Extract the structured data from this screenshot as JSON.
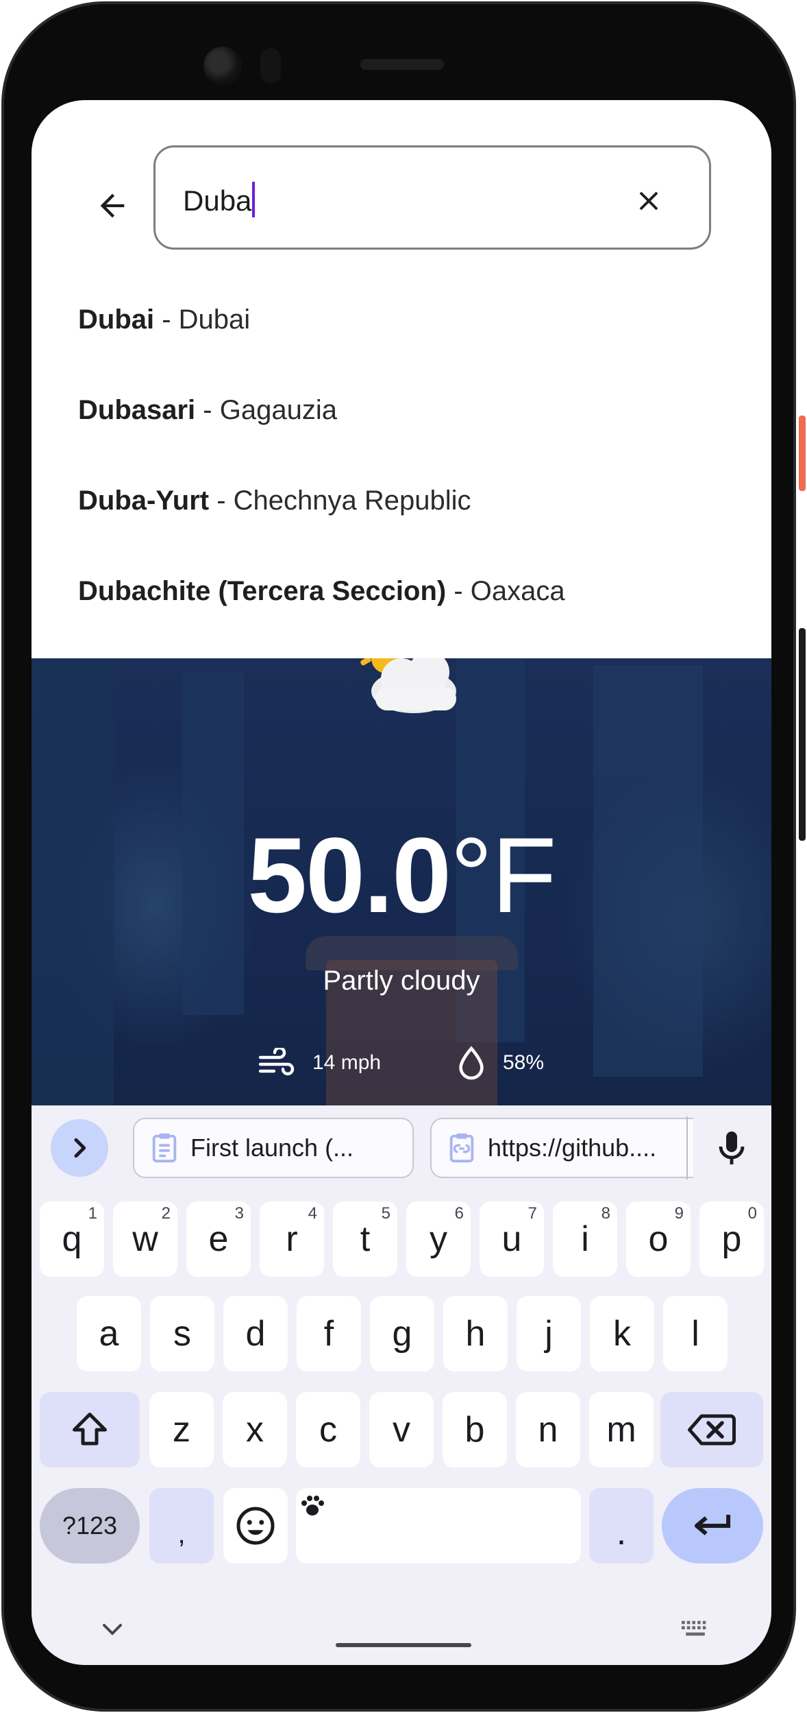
{
  "search": {
    "query": "Duba",
    "back_icon": "arrow-back-icon",
    "clear_icon": "close-icon"
  },
  "suggestions": [
    {
      "name": "Dubai",
      "region": " - Dubai"
    },
    {
      "name": "Dubasari",
      "region": " - Gagauzia"
    },
    {
      "name": "Duba-Yurt",
      "region": " - Chechnya Republic"
    },
    {
      "name": "Dubachite (Tercera Seccion)",
      "region": " - Oaxaca"
    }
  ],
  "weather": {
    "temperature": "50.0",
    "unit": "°F",
    "condition": "Partly cloudy",
    "wind": "14 mph",
    "humidity": "58%",
    "condition_icon": "partly-cloudy-icon"
  },
  "keyboard": {
    "clipboard_chips": [
      "First launch (...",
      "https://github...."
    ],
    "row1": [
      {
        "key": "q",
        "hint": "1"
      },
      {
        "key": "w",
        "hint": "2"
      },
      {
        "key": "e",
        "hint": "3"
      },
      {
        "key": "r",
        "hint": "4"
      },
      {
        "key": "t",
        "hint": "5"
      },
      {
        "key": "y",
        "hint": "6"
      },
      {
        "key": "u",
        "hint": "7"
      },
      {
        "key": "i",
        "hint": "8"
      },
      {
        "key": "o",
        "hint": "9"
      },
      {
        "key": "p",
        "hint": "0"
      }
    ],
    "row2": [
      "a",
      "s",
      "d",
      "f",
      "g",
      "h",
      "j",
      "k",
      "l"
    ],
    "row3": [
      "z",
      "x",
      "c",
      "v",
      "b",
      "n",
      "m"
    ],
    "symbols_label": "?123",
    "comma": ",",
    "period": "."
  },
  "colors": {
    "caret": "#6b20d8",
    "weather_bg": "#172a52",
    "keyboard_bg": "#f1eff7",
    "function_key": "#dde0f8",
    "enter_key": "#b9c8fc"
  }
}
